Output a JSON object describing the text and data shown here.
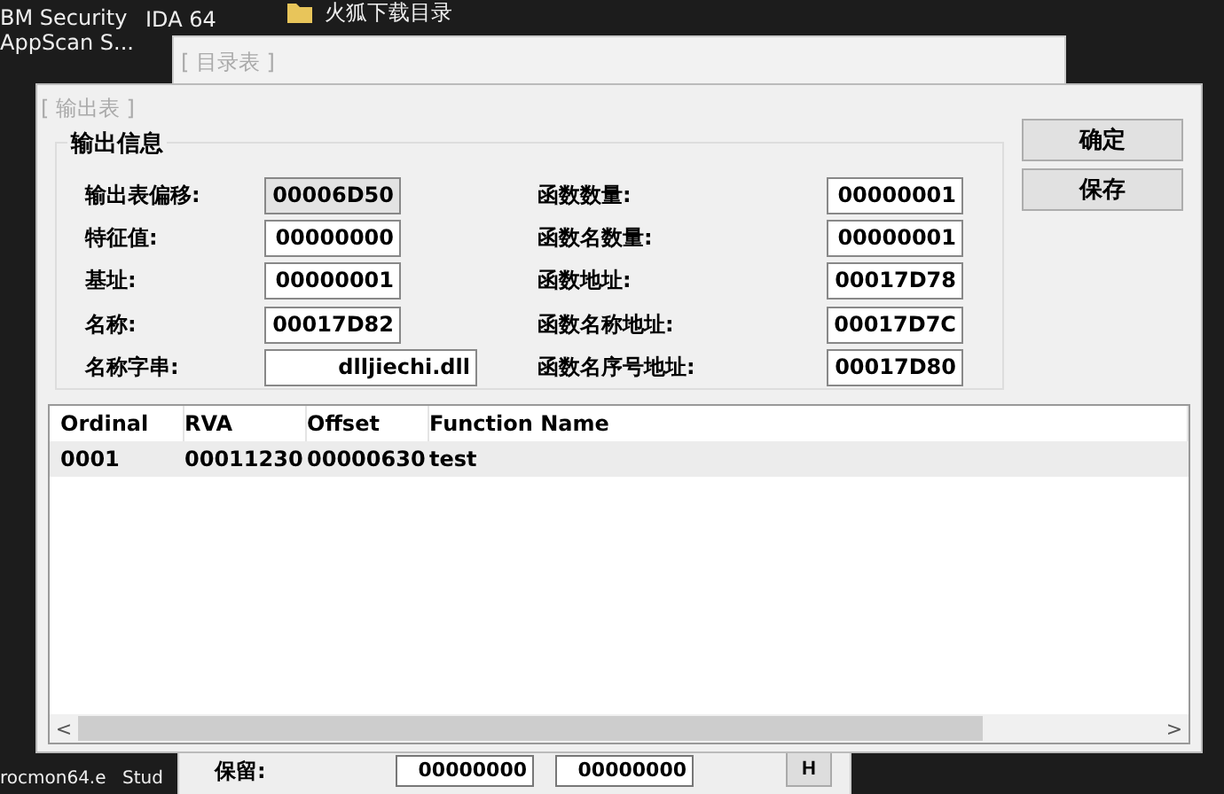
{
  "desktop": {
    "icons": [
      {
        "label": "BM Security\nAppScan S..."
      },
      {
        "label": "IDA 64"
      },
      {
        "label": "火狐下载目录"
      }
    ],
    "bottom_labels": [
      "rocmon64.e",
      "Stud"
    ]
  },
  "back_window": {
    "title": "[ 目录表 ]"
  },
  "bottom_window": {
    "label": "保留:",
    "fields": [
      "00000000",
      "00000000"
    ],
    "button": "H"
  },
  "dialog": {
    "title": "[ 输出表 ]",
    "group_title": "输出信息",
    "left_fields": [
      {
        "label": "输出表偏移:",
        "value": "00006D50",
        "readonly": true
      },
      {
        "label": "特征值:",
        "value": "00000000",
        "readonly": false
      },
      {
        "label": "基址:",
        "value": "00000001",
        "readonly": false
      },
      {
        "label": "名称:",
        "value": "00017D82",
        "readonly": false
      },
      {
        "label": "名称字串:",
        "value": "dlljiechi.dll",
        "readonly": false
      }
    ],
    "right_fields": [
      {
        "label": "函数数量:",
        "value": "00000001",
        "readonly": false
      },
      {
        "label": "函数名数量:",
        "value": "00000001",
        "readonly": false
      },
      {
        "label": "函数地址:",
        "value": "00017D78",
        "readonly": false
      },
      {
        "label": "函数名称地址:",
        "value": "00017D7C",
        "readonly": false
      },
      {
        "label": "函数名序号地址:",
        "value": "00017D80",
        "readonly": false
      }
    ],
    "buttons": [
      "确定",
      "保存"
    ],
    "table": {
      "columns": [
        "Ordinal",
        "RVA",
        "Offset",
        "Function Name"
      ],
      "rows": [
        {
          "cells": [
            "0001",
            "00011230",
            "00000630",
            "test"
          ],
          "selected": true
        }
      ]
    },
    "scroll_left": "<",
    "scroll_right": ">"
  }
}
